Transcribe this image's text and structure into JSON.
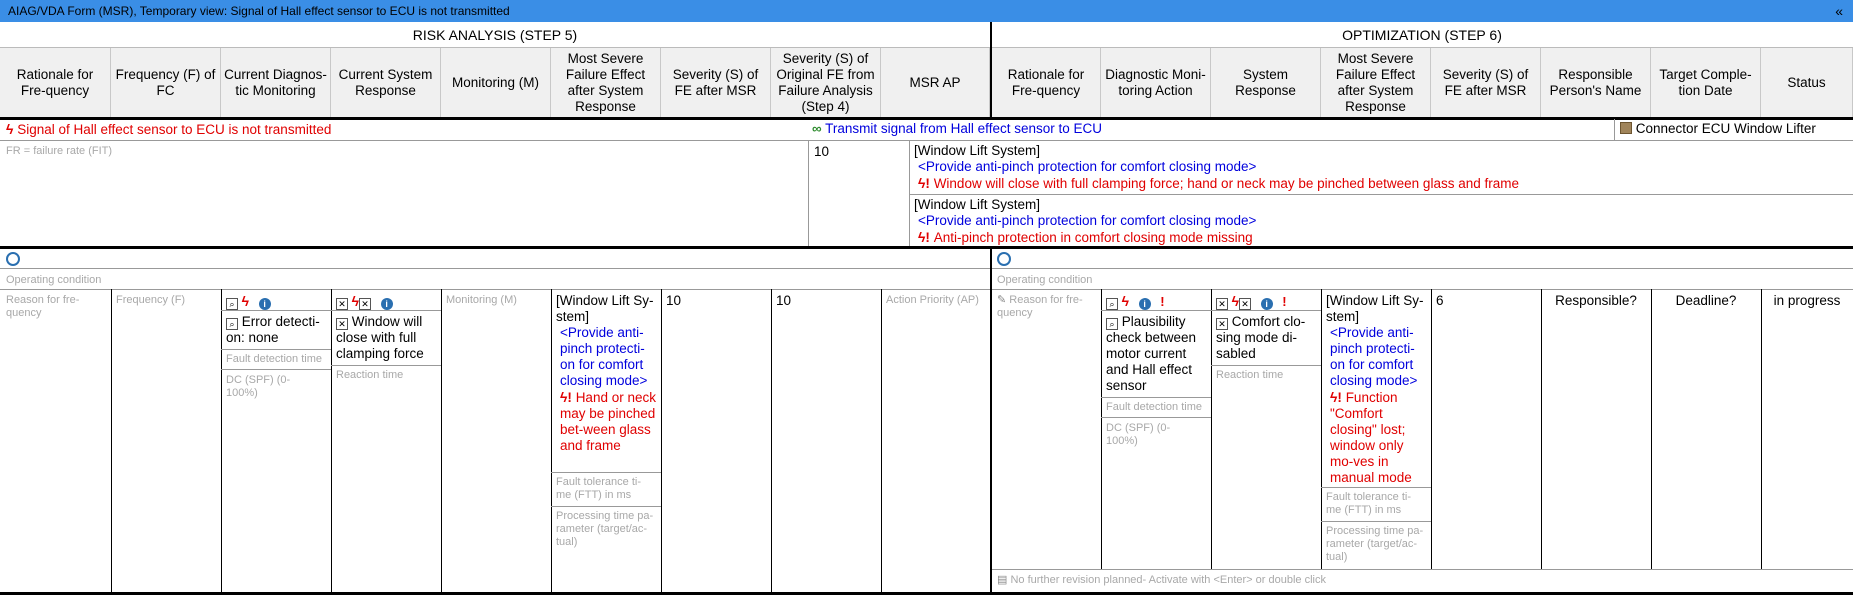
{
  "window": {
    "title": "AIAG/VDA Form (MSR), Temporary view: Signal of Hall effect sensor to ECU is not transmitted",
    "collapse_glyph": "«"
  },
  "sections": {
    "risk": "RISK ANALYSIS (STEP 5)",
    "opt": "OPTIMIZATION  (STEP 6)"
  },
  "headers": [
    "Rationale for Fre-quency",
    "Frequency (F) of FC",
    "Current Diagnos-tic Monitoring",
    "Current System Response",
    "Monitoring (M)",
    "Most Severe Failure Effect after System Response",
    "Severity (S) of FE after MSR",
    "Severity (S) of Original FE from Failure Analysis (Step 4)",
    "MSR AP",
    "Rationale for Fre-quency",
    "Diagnostic Moni-toring Action",
    "System Response",
    "Most Severe Failure Effect after System Response",
    "Severity (S) of FE after MSR",
    "Responsible Person's Name",
    "Target Comple-tion Date",
    "Status"
  ],
  "row1": {
    "failure_cause": "Signal of Hall effect sensor to ECU is not transmitted",
    "function": "Transmit signal from Hall effect sensor to ECU",
    "element": "Connector ECU Window Lifter",
    "fr_placeholder": "FR = failure rate (FIT)",
    "severity": "10",
    "effects": [
      {
        "system": "[Window Lift System]",
        "function": "<Provide anti-pinch protection for comfort closing mode>",
        "failure": "Window will close with full clamping force; hand or neck may be pinched between glass and frame"
      },
      {
        "system": "[Window Lift System]",
        "function": "<Provide anti-pinch protection for comfort closing mode>",
        "failure": "Anti-pinch protection in comfort closing mode missing"
      }
    ]
  },
  "risk": {
    "operating_condition": "Operating condition",
    "reason_placeholder": "Reason for fre-quency",
    "frequency_placeholder": "Frequency (F)",
    "diagnostic": "Error detecti-on: none",
    "fault_detection_time": "Fault detection time",
    "dc_spf": "DC (SPF) (0-100%)",
    "system_response": "Window will close with full clamping force",
    "reaction_time": "Reaction time",
    "monitoring_placeholder": "Monitoring (M)",
    "effect_system": "[Window Lift Sy-stem]",
    "effect_function": "<Provide anti-pinch protecti-on for comfort closing mode>",
    "effect_failure": "Hand or neck may be pinched bet-ween glass and frame",
    "ftt": "Fault tolerance ti-me (FTT) in ms",
    "processing_time": "Processing time pa-rameter (target/ac-tual)",
    "severity_msr": "10",
    "severity_orig": "10",
    "ap_placeholder": "Action Priority (AP)"
  },
  "opt": {
    "operating_condition": "Operating condition",
    "reason_placeholder": "Reason for fre-quency",
    "diagnostic": "Plausibility check between motor current and Hall effect sensor",
    "fault_detection_time": "Fault detection time",
    "dc_spf": "DC (SPF) (0-100%)",
    "system_response": "Comfort clo-sing mode di-sabled",
    "reaction_time": "Reaction time",
    "effect_system": "[Window Lift Sy-stem]",
    "effect_function": "<Provide anti-pinch protecti-on for comfort closing mode>",
    "effect_failure": "Function \"Comfort closing\" lost; window only mo-ves in manual mode",
    "ftt": "Fault tolerance ti-me (FTT) in ms",
    "processing_time": "Processing time pa-rameter (target/ac-tual)",
    "severity": "6",
    "responsible": "Responsible?",
    "deadline": "Deadline?",
    "status": "in progress",
    "revision": "No further revision planned- Activate with <Enter> or double click"
  },
  "icons": {
    "failure_cause": "lightning-icon",
    "function": "link-icon",
    "element": "component-icon",
    "operating": "steering-wheel-icon",
    "info": "i",
    "warn": "!"
  }
}
